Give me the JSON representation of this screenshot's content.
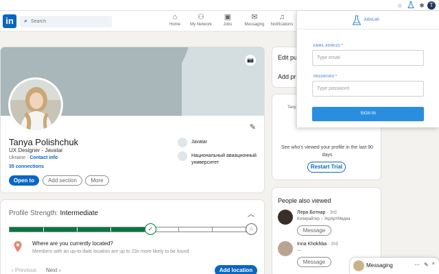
{
  "browser": {
    "extensions": [
      "star-icon",
      "flask-icon",
      "puzzle-icon"
    ],
    "profile_initial": "T"
  },
  "header": {
    "logo": "in",
    "search_placeholder": "Search",
    "nav": [
      {
        "label": "Home",
        "icon": "home-icon"
      },
      {
        "label": "My Network",
        "icon": "network-icon"
      },
      {
        "label": "Jobs",
        "icon": "briefcase-icon"
      },
      {
        "label": "Messaging",
        "icon": "chat-icon"
      },
      {
        "label": "Notifications",
        "icon": "bell-icon"
      }
    ]
  },
  "profile": {
    "name": "Tanya Polishchuk",
    "headline": "UX Designer - Javatar",
    "location": "Ukraine",
    "contact_info": "Contact info",
    "connections": "35 connections",
    "buttons": {
      "open_to": "Open to",
      "add_section": "Add section",
      "more": "More"
    },
    "organizations": [
      {
        "name": "Javatar"
      },
      {
        "name": "Национальный авиационный университет"
      }
    ]
  },
  "strength": {
    "label": "Profile Strength:",
    "level": "Intermediate",
    "progress": 0.6,
    "segments": 7,
    "question": "Where are you currently located?",
    "hint": "Members with an up-to-date location are up to 23x more likely to be found",
    "previous": "Previous",
    "next": "Next",
    "add_location": "Add location"
  },
  "sidebar": {
    "edit_rows": [
      "Edit pub",
      "Add pro"
    ],
    "trial": {
      "name_snippet": "Tanya",
      "desc": "See who's viewed your profile in the last 90 days",
      "button": "Restart Trial"
    },
    "people_also_viewed": {
      "title": "People also viewed",
      "people": [
        {
          "name": "Лера Ботнар",
          "degree": "· 3rd",
          "role": "Копирайтер – УкрАртМедиа",
          "button": "Message"
        },
        {
          "name": "Inna Khokhba",
          "degree": "· 3rd",
          "role": "—",
          "button": "Message"
        }
      ]
    }
  },
  "messaging": {
    "label": "Messaging",
    "icons": [
      "ellipsis-icon",
      "compose-icon",
      "chevron-up-icon"
    ]
  },
  "popup": {
    "brand": "JobsLab",
    "email_label": "EMAIL ADRESS",
    "email_placeholder": "Type email",
    "password_label": "PASSWORD",
    "password_placeholder": "Type password",
    "required_mark": "*",
    "signin": "SIGN IN"
  },
  "colors": {
    "linkedin_blue": "#0a66c2",
    "progress_green": "#057642",
    "jobslab_blue": "#2a8ee0",
    "banner": "#a9b6ba"
  }
}
